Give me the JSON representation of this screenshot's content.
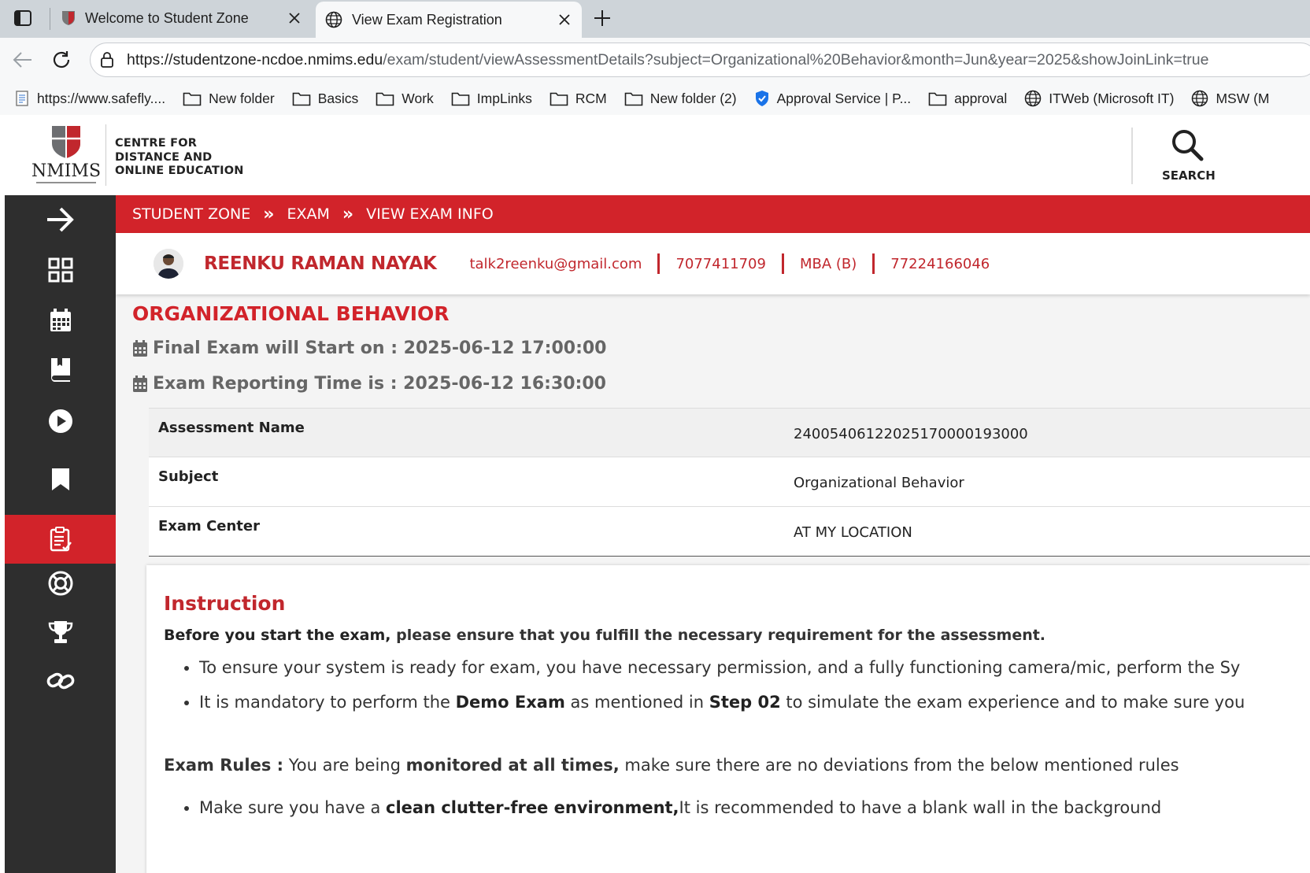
{
  "browser": {
    "tabs": [
      {
        "title": "Welcome to Student Zone",
        "active": false
      },
      {
        "title": "View Exam Registration",
        "active": true
      }
    ],
    "url_host": "https://studentzone-ncdoe.nmims.edu",
    "url_path": "/exam/student/viewAssessmentDetails?subject=Organizational%20Behavior&month=Jun&year=2025&showJoinLink=true",
    "bookmarks": [
      {
        "label": "https://www.safefly....",
        "icon": "page-icon"
      },
      {
        "label": "New folder",
        "icon": "folder-icon"
      },
      {
        "label": "Basics",
        "icon": "folder-icon"
      },
      {
        "label": "Work",
        "icon": "folder-icon"
      },
      {
        "label": "ImpLinks",
        "icon": "folder-icon"
      },
      {
        "label": "RCM",
        "icon": "folder-icon"
      },
      {
        "label": "New folder (2)",
        "icon": "folder-icon"
      },
      {
        "label": "Approval Service | P...",
        "icon": "shield-check-icon"
      },
      {
        "label": "approval",
        "icon": "folder-icon"
      },
      {
        "label": "ITWeb (Microsoft IT)",
        "icon": "globe-icon"
      },
      {
        "label": "MSW (M",
        "icon": "globe-icon"
      }
    ]
  },
  "header": {
    "logo_text_line1": "CENTRE FOR",
    "logo_text_line2": "DISTANCE AND",
    "logo_text_line3": "ONLINE EDUCATION",
    "logo_wordmark": "NMIMS",
    "search_label": "SEARCH"
  },
  "sidebar": {
    "items": [
      {
        "icon": "arrow-right-icon",
        "active": false
      },
      {
        "icon": "grid-icon",
        "active": false
      },
      {
        "icon": "calendar-icon",
        "active": false
      },
      {
        "icon": "book-icon",
        "active": false
      },
      {
        "icon": "play-icon",
        "active": false
      },
      {
        "icon": "bookmark-icon",
        "active": false
      },
      {
        "icon": "exam-checklist-icon",
        "active": true
      },
      {
        "icon": "lifebuoy-icon",
        "active": false
      },
      {
        "icon": "trophy-icon",
        "active": false
      },
      {
        "icon": "link-icon",
        "active": false
      }
    ]
  },
  "breadcrumb": {
    "items": [
      "STUDENT ZONE",
      "EXAM",
      "VIEW EXAM INFO"
    ],
    "separator": "»"
  },
  "profile": {
    "name": "REENKU RAMAN NAYAK",
    "email": "talk2reenku@gmail.com",
    "phone": "7077411709",
    "program": "MBA (B)",
    "student_id": "77224166046"
  },
  "exam": {
    "subject_title": "ORGANIZATIONAL BEHAVIOR",
    "start_line": "Final Exam will Start on : 2025-06-12 17:00:00",
    "reporting_line": "Exam Reporting Time is : 2025-06-12 16:30:00",
    "details": [
      {
        "label": "Assessment Name",
        "value": "240054061220251700001930​00"
      },
      {
        "label": "Subject",
        "value": "Organizational Behavior"
      },
      {
        "label": "Exam Center",
        "value": "AT MY LOCATION"
      }
    ]
  },
  "instructions": {
    "title": "Instruction",
    "lead_bold": "Before you start the exam,",
    "lead_rest": " please ensure that you fulfill the necessary requirement for the assessment.",
    "bullet1": "To ensure your system is ready for exam, you have necessary permission, and a fully functioning camera/mic, perform the Sy",
    "bullet2_a": "It is mandatory to perform the ",
    "bullet2_b": "Demo Exam",
    "bullet2_c": " as mentioned in ",
    "bullet2_d": "Step 02",
    "bullet2_e": " to simulate the exam experience and to make sure you",
    "rules_label": "Exam Rules :",
    "rules_a": " You are being ",
    "rules_b": "monitored at all times,",
    "rules_c": " make sure there are no deviations from the below mentioned rules",
    "rule1_a": "Make sure you have a ",
    "rule1_b": "clean clutter-free environment,",
    "rule1_c": "It is recommended to have a blank wall in the background"
  },
  "colors": {
    "brand_red": "#d2232a",
    "sidebar_bg": "#2e2e2e",
    "page_bg": "#f4f4f4"
  }
}
